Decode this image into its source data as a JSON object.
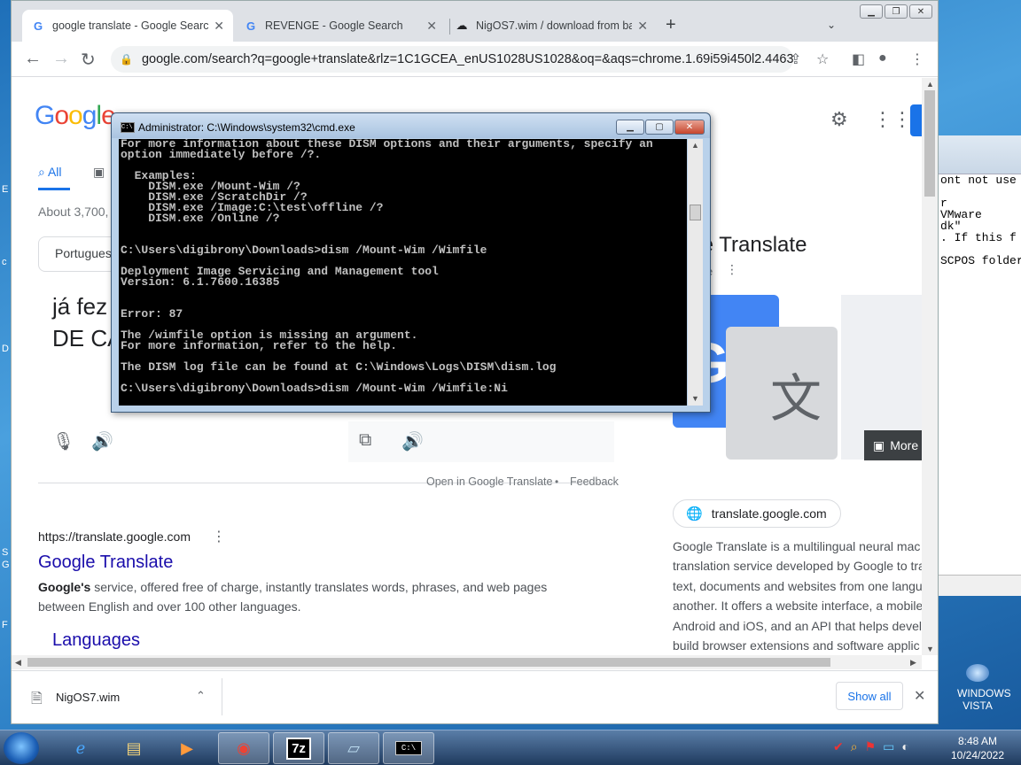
{
  "browser": {
    "tabs": [
      {
        "title": "google translate - Google Search",
        "favicon": "G"
      },
      {
        "title": "REVENGE - Google Search",
        "favicon": "G"
      },
      {
        "title": "NigOS7.wim / download from ba",
        "favicon": "cloud-icon"
      }
    ],
    "url": "google.com/search?q=google+translate&rlz=1C1GCEA_enUS1028US1028&oq=&aqs=chrome.1.69i59i450l2.44635...",
    "page": {
      "logo": "Google",
      "tab_all": "All",
      "results_count": "About 3,700,",
      "lang_chip": "Portugues",
      "translated_line1": "já fez",
      "translated_line2": "DE CA",
      "open_in_translate": "Open in Google Translate",
      "dot": "•",
      "feedback": "Feedback",
      "result_url": "https://translate.google.com",
      "result_title": "Google Translate",
      "snippet_bold": "Google's",
      "snippet_rest": " service, offered free of charge, instantly translates words, phrases, and web pages between English and over 100 other languages.",
      "sub_link": "Languages",
      "kp_title": "gle Translate",
      "kp_sub": "e",
      "more_label": "More",
      "site_chip": "translate.google.com",
      "kp_desc": "Google Translate is a multilingual neural mac translation service developed by Google to tra text, documents and websites from one langu another. It offers a website interface, a mobile Android and iOS, and an API that helps develo build browser extensions and software applic"
    },
    "download": {
      "file": "NigOS7.wim",
      "show_all": "Show all"
    }
  },
  "cmd": {
    "title": "Administrator: C:\\Windows\\system32\\cmd.exe",
    "icon_text": "C:\\",
    "lines": [
      "For more information about these DISM options and their arguments, specify an",
      "option immediately before /?.",
      "",
      "  Examples:",
      "    DISM.exe /Mount-Wim /?",
      "    DISM.exe /ScratchDir /?",
      "    DISM.exe /Image:C:\\test\\offline /?",
      "    DISM.exe /Online /?",
      "",
      "",
      "C:\\Users\\digibrony\\Downloads>dism /Mount-Wim /Wimfile",
      "",
      "Deployment Image Servicing and Management tool",
      "Version: 6.1.7600.16385",
      "",
      "",
      "Error: 87",
      "",
      "The /wimfile option is missing an argument.",
      "For more information, refer to the help.",
      "",
      "The DISM log file can be found at C:\\Windows\\Logs\\DISM\\dism.log",
      "",
      "C:\\Users\\digibrony\\Downloads>dism /Mount-Wim /Wimfile:Ni"
    ]
  },
  "notepad": {
    "lines": [
      "ont not use",
      "",
      "r",
      "VMware",
      "dk\"",
      ". If this f",
      "",
      "SCPOS folder"
    ]
  },
  "desktop": {
    "edge_letters": [
      "E",
      "c",
      "D",
      "S",
      "G",
      "F"
    ],
    "vista_label_1": "WINDOWS",
    "vista_label_2": "VISTA"
  },
  "taskbar": {
    "items": [
      "internet-explorer-icon",
      "file-explorer-icon",
      "media-player-icon",
      "chrome-icon",
      "7zip-icon",
      "notepad-icon",
      "cmd-icon"
    ],
    "label_7z": "7z",
    "time": "8:48 AM",
    "date": "10/24/2022"
  }
}
